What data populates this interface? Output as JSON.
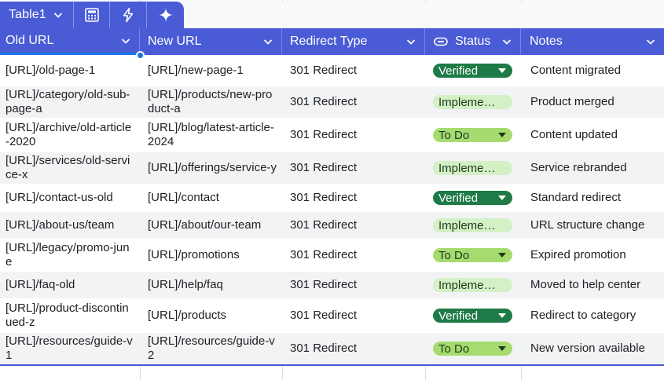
{
  "table_tab": {
    "name": "Table1",
    "icons": [
      "chevron-down-icon",
      "calculator-icon",
      "lightning-icon",
      "sparkle-icon"
    ]
  },
  "columns": [
    {
      "label": "Old URL",
      "icon": "chevron-down-icon"
    },
    {
      "label": "New URL",
      "icon": "chevron-down-icon"
    },
    {
      "label": "Redirect Type",
      "icon": "chevron-down-icon"
    },
    {
      "label": "Status",
      "icon": "chevron-down-icon",
      "leading_icon": "toggle-icon"
    },
    {
      "label": "Notes",
      "icon": "chevron-down-icon"
    }
  ],
  "rows": [
    {
      "old_url": "[URL]/old-page-1",
      "new_url": "[URL]/new-page-1",
      "redirect_type": "301 Redirect",
      "status": "Verified",
      "notes": "Content migrated"
    },
    {
      "old_url": "[URL]/category/old-sub-page-a",
      "new_url": "[URL]/products/new-product-a",
      "redirect_type": "301 Redirect",
      "status": "Impleme…",
      "notes": "Product merged"
    },
    {
      "old_url": "[URL]/archive/old-article-2020",
      "new_url": "[URL]/blog/latest-article-2024",
      "redirect_type": "301 Redirect",
      "status": "To Do",
      "notes": "Content updated"
    },
    {
      "old_url": "[URL]/services/old-service-x",
      "new_url": "[URL]/offerings/service-y",
      "redirect_type": "301 Redirect",
      "status": "Impleme…",
      "notes": "Service rebranded"
    },
    {
      "old_url": "[URL]/contact-us-old",
      "new_url": "[URL]/contact",
      "redirect_type": "301 Redirect",
      "status": "Verified",
      "notes": "Standard redirect"
    },
    {
      "old_url": "[URL]/about-us/team",
      "new_url": "[URL]/about/our-team",
      "redirect_type": "301 Redirect",
      "status": "Impleme…",
      "notes": "URL structure change"
    },
    {
      "old_url": "[URL]/legacy/promo-june",
      "new_url": "[URL]/promotions",
      "redirect_type": "301 Redirect",
      "status": "To Do",
      "notes": "Expired promotion"
    },
    {
      "old_url": "[URL]/faq-old",
      "new_url": "[URL]/help/faq",
      "redirect_type": "301 Redirect",
      "status": "Impleme…",
      "notes": "Moved to help center"
    },
    {
      "old_url": "[URL]/product-discontinued-z",
      "new_url": "[URL]/products",
      "redirect_type": "301 Redirect",
      "status": "Verified",
      "notes": "Redirect to category"
    },
    {
      "old_url": "[URL]/resources/guide-v1",
      "new_url": "[URL]/resources/guide-v2",
      "redirect_type": "301 Redirect",
      "status": "To Do",
      "notes": "New version available"
    }
  ],
  "status_colors": {
    "Verified": "#1e7a46",
    "Implemented": "#d4f0c5",
    "To Do": "#a6db6f"
  },
  "accent": "#4a5bd6"
}
